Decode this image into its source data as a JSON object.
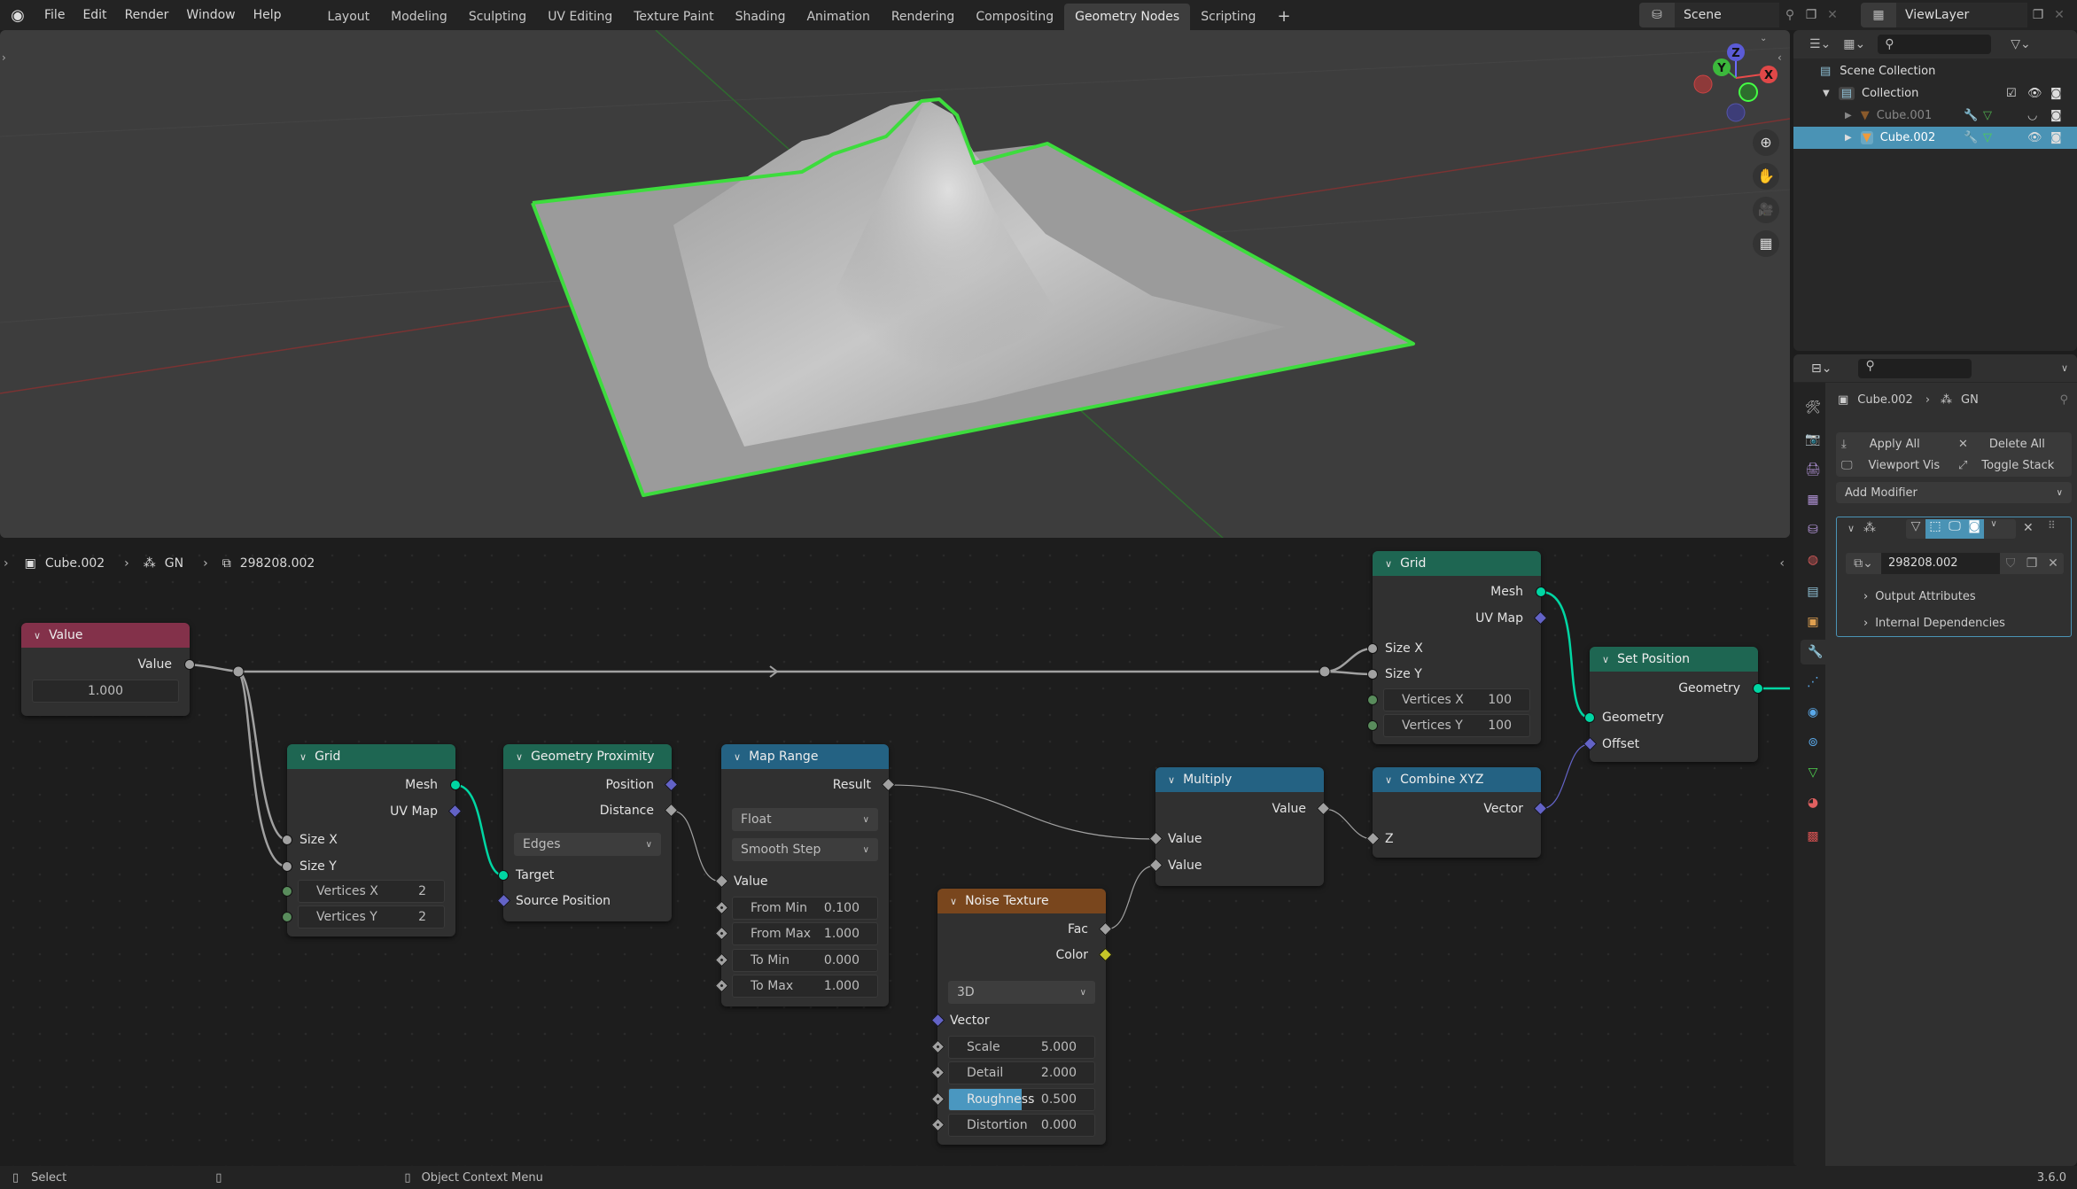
{
  "app": {
    "logo": "blender-logo-icon",
    "version": "3.6.0"
  },
  "menu": [
    "File",
    "Edit",
    "Render",
    "Window",
    "Help"
  ],
  "workspaces": [
    "Layout",
    "Modeling",
    "Sculpting",
    "UV Editing",
    "Texture Paint",
    "Shading",
    "Animation",
    "Rendering",
    "Compositing",
    "Geometry Nodes",
    "Scripting"
  ],
  "active_workspace": "Geometry Nodes",
  "add_workspace": "+",
  "scene": {
    "name": "Scene",
    "view_layer": "ViewLayer"
  },
  "viewport": {
    "gizmo": {
      "x": "X",
      "y": "Y",
      "z": "Z"
    },
    "tools": [
      "zoom-icon",
      "pan-hand-icon",
      "camera-icon",
      "grid-ortho-icon"
    ],
    "selection_color": "#3ddc3d"
  },
  "outliner": {
    "search_placeholder": "",
    "items": [
      {
        "label": "Scene Collection",
        "level": 0
      },
      {
        "label": "Collection",
        "level": 1
      },
      {
        "label": "Cube.001",
        "level": 2,
        "selected": false
      },
      {
        "label": "Cube.002",
        "level": 2,
        "selected": true
      }
    ]
  },
  "node_editor": {
    "breadcrumb": [
      "Cube.002",
      "GN",
      "298208.002"
    ],
    "nodes": {
      "value": {
        "title": "Value",
        "out": "Value",
        "field": "1.000"
      },
      "grid1": {
        "title": "Grid",
        "out": [
          "Mesh",
          "UV Map"
        ],
        "in": [
          "Size X",
          "Size Y"
        ],
        "props": [
          {
            "label": "Vertices X",
            "value": "2"
          },
          {
            "label": "Vertices Y",
            "value": "2"
          }
        ]
      },
      "geoprox": {
        "title": "Geometry Proximity",
        "out": [
          "Position",
          "Distance"
        ],
        "mode": "Edges",
        "in": [
          "Target",
          "Source Position"
        ]
      },
      "maprange": {
        "title": "Map Range",
        "out": "Result",
        "type": "Float",
        "interp": "Smooth Step",
        "in": "Value",
        "props": [
          {
            "label": "From Min",
            "value": "0.100"
          },
          {
            "label": "From Max",
            "value": "1.000"
          },
          {
            "label": "To Min",
            "value": "0.000"
          },
          {
            "label": "To Max",
            "value": "1.000"
          }
        ]
      },
      "noise": {
        "title": "Noise Texture",
        "out": [
          "Fac",
          "Color"
        ],
        "dims": "3D",
        "in": "Vector",
        "props": [
          {
            "label": "Scale",
            "value": "5.000"
          },
          {
            "label": "Detail",
            "value": "2.000"
          },
          {
            "label": "Roughness",
            "value": "0.500",
            "fill": 0.5
          },
          {
            "label": "Distortion",
            "value": "0.000"
          }
        ]
      },
      "multiply": {
        "title": "Multiply",
        "out": "Value",
        "in": [
          "Value",
          "Value"
        ]
      },
      "combine": {
        "title": "Combine XYZ",
        "out": "Vector",
        "in": "Z"
      },
      "grid2": {
        "title": "Grid",
        "out": [
          "Mesh",
          "UV Map"
        ],
        "in": [
          "Size X",
          "Size Y"
        ],
        "props": [
          {
            "label": "Vertices X",
            "value": "100"
          },
          {
            "label": "Vertices Y",
            "value": "100"
          }
        ]
      },
      "setpos": {
        "title": "Set Position",
        "out": "Geometry",
        "in": [
          "Geometry",
          "Offset"
        ]
      }
    },
    "colors": {
      "input_header": "#83314a",
      "geometry_header": "#1e6652",
      "converter_header": "#246283",
      "texture_header": "#79461d",
      "geometry_socket": "#00d6a3",
      "vector_socket": "#6363c7",
      "float_socket": "#a1a1a1",
      "int_socket": "#598c5c",
      "color_socket": "#c7c729"
    }
  },
  "properties": {
    "breadcrumb": [
      "Cube.002",
      "GN"
    ],
    "apply_all": "Apply All",
    "delete_all": "Delete All",
    "viewport_vis": "Viewport Vis",
    "toggle_stack": "Toggle Stack",
    "add_modifier": "Add Modifier",
    "node_group": "298208.002",
    "panels": [
      "Output Attributes",
      "Internal Dependencies"
    ],
    "tabs": [
      "tool",
      "render",
      "output",
      "view-layer",
      "scene",
      "world",
      "collection",
      "object",
      "modifiers",
      "particles",
      "physics",
      "constraints",
      "data",
      "material",
      "texture"
    ],
    "active_tab": "modifiers"
  },
  "status": {
    "select": "Select",
    "context_menu": "Object Context Menu"
  }
}
